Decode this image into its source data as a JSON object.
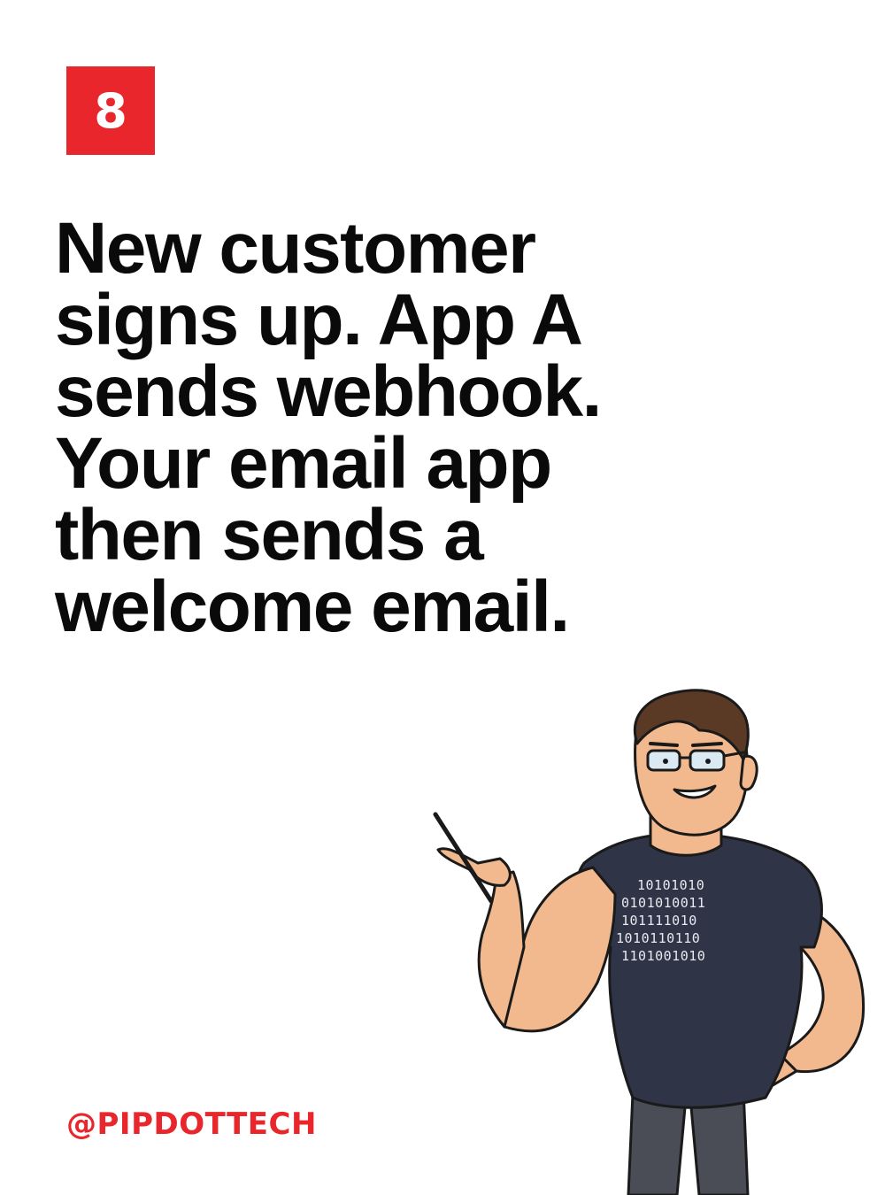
{
  "slide": {
    "number": "8",
    "headline_lines": [
      "New customer",
      "signs up. App A",
      "sends webhook.",
      "Your email app",
      "then sends a",
      "welcome email."
    ],
    "handle": "@PIPDOTTECH"
  },
  "illustration": {
    "shirt_code_lines": [
      "10101010",
      "0101010011",
      "101111010",
      "1010110110",
      "1101001010"
    ]
  },
  "colors": {
    "accent": "#e8262b",
    "text": "#0a0a0a",
    "background": "#ffffff",
    "shirt": "#2f3447",
    "pants": "#4a4d55",
    "skin": "#f2b98e",
    "hair": "#5a3a24"
  }
}
